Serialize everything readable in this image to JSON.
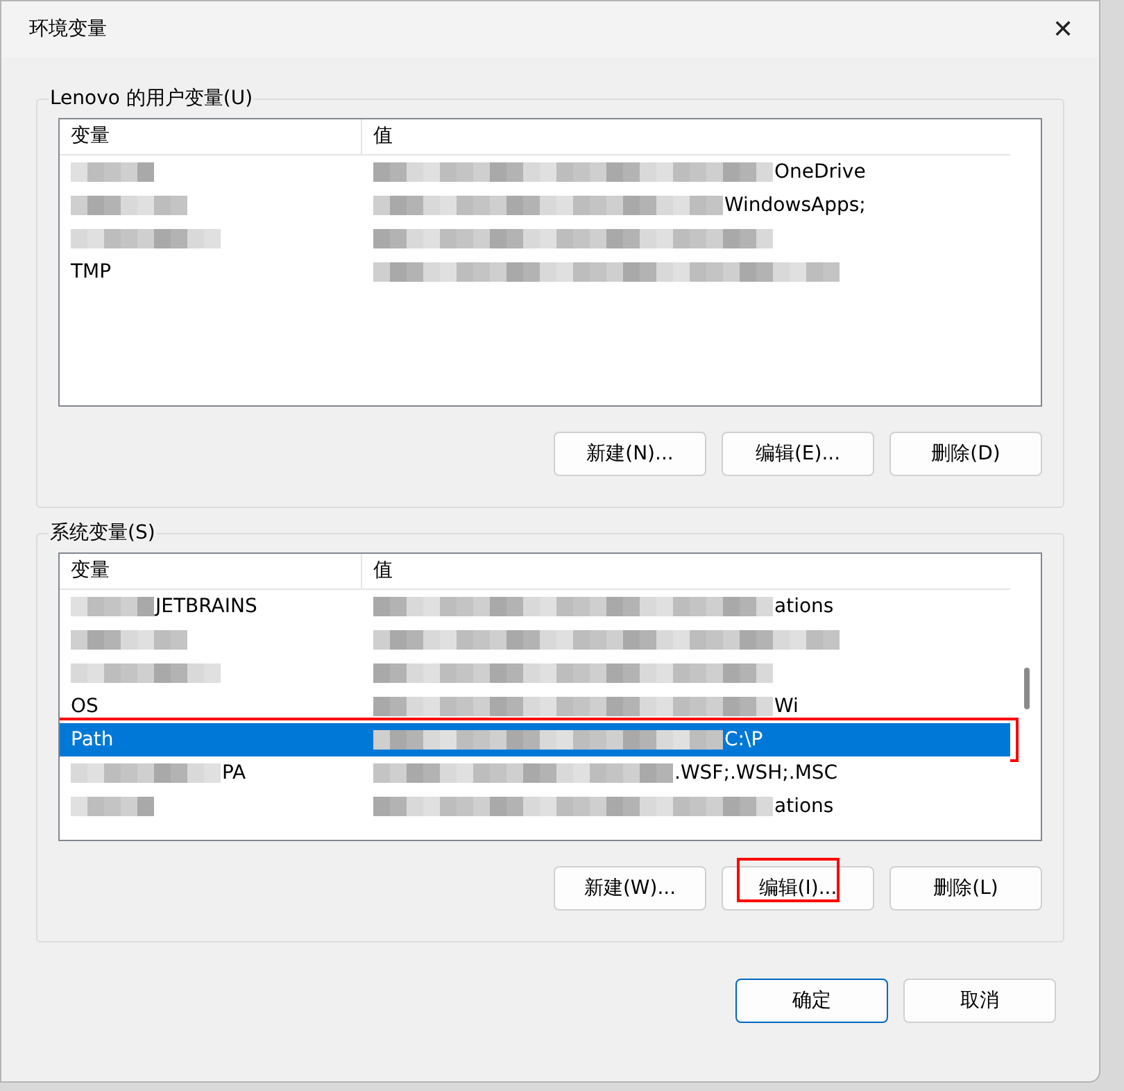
{
  "window": {
    "title": "环境变量",
    "close": "✕"
  },
  "user_vars": {
    "label": "Lenovo 的用户变量(U)",
    "columns": [
      "变量",
      "值"
    ],
    "rows": [
      {
        "selected": false,
        "highlighted": false,
        "name": {
          "blurred": true
        },
        "value": {
          "blurred": true,
          "text": "OneDrive"
        }
      },
      {
        "selected": false,
        "highlighted": false,
        "name": {
          "blurred": true
        },
        "value": {
          "blurred": true,
          "text": "WindowsApps;"
        }
      },
      {
        "selected": false,
        "highlighted": false,
        "name": {
          "blurred": true
        },
        "value": {
          "blurred": true
        }
      },
      {
        "selected": false,
        "highlighted": false,
        "name": {
          "text": "TMP",
          "blurred": false
        },
        "value": {
          "blurred": true
        }
      }
    ],
    "buttons": [
      {
        "label": "新建(N)...",
        "highlighted": false
      },
      {
        "label": "编辑(E)...",
        "highlighted": false
      },
      {
        "label": "删除(D)",
        "highlighted": false
      }
    ]
  },
  "system_vars": {
    "label": "系统变量(S)",
    "columns": [
      "变量",
      "值"
    ],
    "rows": [
      {
        "selected": false,
        "highlighted": false,
        "name": {
          "text": "JETBRAINS",
          "blurred": true
        },
        "value": {
          "blurred": true,
          "text": "ations"
        }
      },
      {
        "selected": false,
        "highlighted": false,
        "name": {
          "blurred": true
        },
        "value": {
          "blurred": true
        }
      },
      {
        "selected": false,
        "highlighted": false,
        "name": {
          "blurred": true
        },
        "value": {
          "blurred": true
        }
      },
      {
        "selected": false,
        "highlighted": false,
        "name": {
          "text": "OS",
          "blurred": false
        },
        "value": {
          "text": "Wi",
          "blurred": true
        }
      },
      {
        "selected": true,
        "highlighted": true,
        "name": {
          "text": "Path",
          "blurred": false
        },
        "value": {
          "text": "C:\\P",
          "blurred": true
        }
      },
      {
        "selected": false,
        "highlighted": false,
        "name": {
          "text": "PA",
          "blurred": true
        },
        "value": {
          "blurred": true,
          "text": ".WSF;.WSH;.MSC"
        }
      },
      {
        "selected": false,
        "highlighted": false,
        "name": {
          "blurred": true
        },
        "value": {
          "blurred": true,
          "text": "ations"
        }
      }
    ],
    "buttons": [
      {
        "label": "新建(W)...",
        "highlighted": false
      },
      {
        "label": "编辑(I)...",
        "highlighted": true
      },
      {
        "label": "删除(L)",
        "highlighted": false
      }
    ]
  },
  "footer_buttons": [
    {
      "label": "确定",
      "default": true
    },
    {
      "label": "取消",
      "default": false
    }
  ]
}
